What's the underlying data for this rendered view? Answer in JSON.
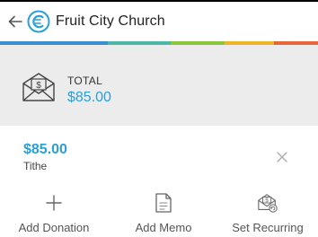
{
  "header": {
    "title": "Fruit City Church",
    "back_icon": "arrow-left-icon",
    "logo_icon": "church-logo-icon"
  },
  "colors": {
    "accent": "#2a9fd8",
    "panel_bg": "#ececec",
    "stripe": [
      "#3b8fd0",
      "#4cb6a8",
      "#8cc63f",
      "#f0b429",
      "#e5673b"
    ]
  },
  "total": {
    "label": "TOTAL",
    "amount": "$85.00",
    "icon": "envelope-dollar-icon"
  },
  "donation": {
    "amount": "$85.00",
    "fund": "Tithe",
    "remove_icon": "close-icon"
  },
  "actions": [
    {
      "label": "Add Donation",
      "icon": "plus-icon"
    },
    {
      "label": "Add Memo",
      "icon": "memo-icon"
    },
    {
      "label": "Set Recurring",
      "icon": "recurring-envelope-icon"
    }
  ]
}
